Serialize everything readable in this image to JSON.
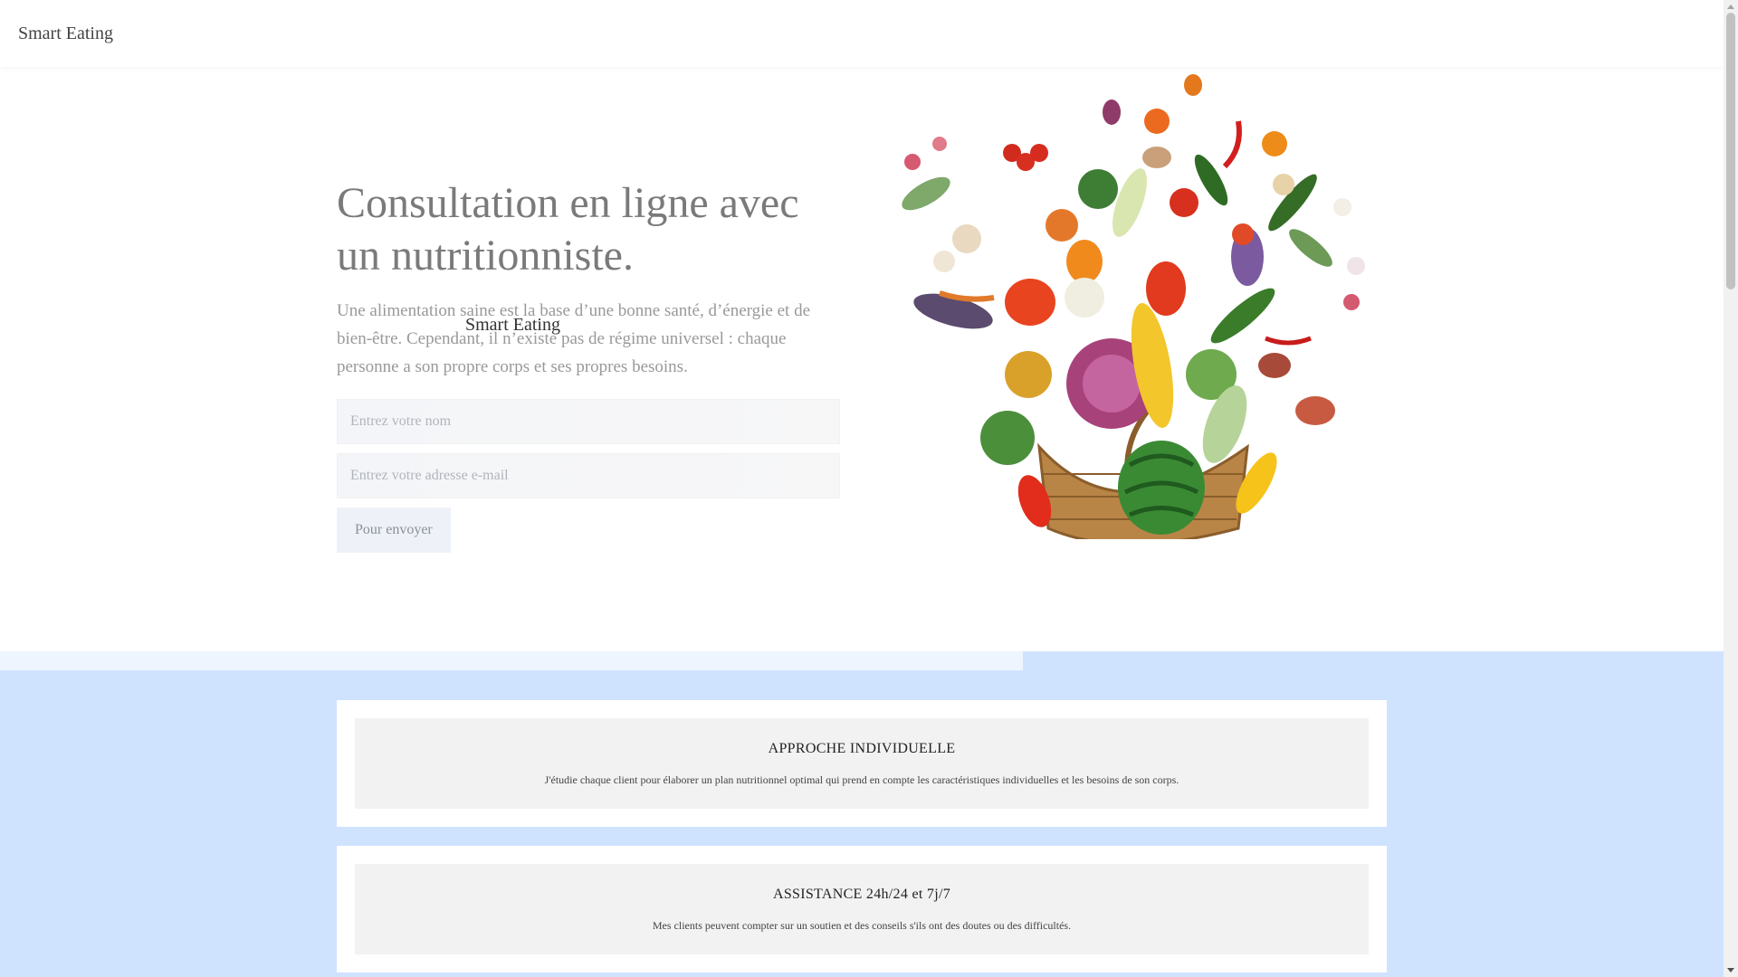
{
  "header": {
    "brand": "Smart Eating"
  },
  "hero": {
    "title": "Consultation en ligne avec un nutritionniste.",
    "description": "Une alimentation saine est la base d’une bonne santé, d’énergie et de bien-être. Cependant, il n’existe pas de régime universel : chaque personne a son propre corps et ses propres besoins.",
    "overlay_brand": "Smart Eating",
    "name_placeholder": "Entrez votre nom",
    "email_placeholder": "Entrez votre adresse e-mail",
    "send_label": "Pour envoyer"
  },
  "features": [
    {
      "title": "APPROCHE INDIVIDUELLE",
      "description": "J'étudie chaque client pour élaborer un plan nutritionnel optimal qui prend en compte les caractéristiques individuelles et les besoins de son corps."
    },
    {
      "title": "ASSISTANCE 24h/24 et 7j/7",
      "description": "Mes clients peuvent compter sur un soutien et des conseils s'ils ont des doutes ou des difficultés."
    }
  ],
  "colors": {
    "page_bg": "#cfe3ff",
    "card_bg": "#ffffff",
    "card_inner": "#f2f2f2"
  }
}
